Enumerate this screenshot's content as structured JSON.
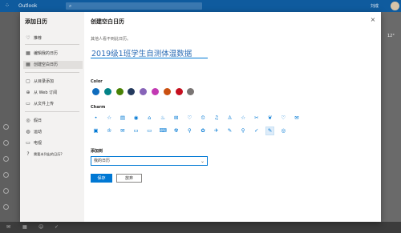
{
  "appbar": {
    "brand": "Outlook",
    "user_name": "刘成"
  },
  "background": {
    "weather": "12°"
  },
  "dialog": {
    "left_title": "添加日历",
    "nav": [
      {
        "icon": "lightbulb-icon",
        "glyph": "♡",
        "label": "推荐"
      },
      {
        "icon": "calendar-edit-icon",
        "glyph": "▦",
        "label": "编辑我的日历"
      },
      {
        "icon": "calendar-add-icon",
        "glyph": "▦",
        "label": "创建空白日历"
      },
      {
        "icon": "folder-import-icon",
        "glyph": "▢",
        "label": "从目录添加"
      },
      {
        "icon": "web-icon",
        "glyph": "⊕",
        "label": "从 Web 订阅"
      },
      {
        "icon": "file-upload-icon",
        "glyph": "▭",
        "label": "从文件上传"
      },
      {
        "icon": "globe-icon",
        "glyph": "◎",
        "label": "假日"
      },
      {
        "icon": "sports-icon",
        "glyph": "◍",
        "label": "运动"
      },
      {
        "icon": "tv-icon",
        "glyph": "▭",
        "label": "电视"
      },
      {
        "icon": "help-icon",
        "glyph": "?",
        "label": "需要未列出的日历?"
      }
    ],
    "title": "创建空白日历",
    "subtitle": "其他人看不到此日历。",
    "calendar_name": "2019级1班学生自测体温数据",
    "color_label": "Color",
    "colors": [
      "#0f6cbd",
      "#038387",
      "#498205",
      "#243a5e",
      "#8764b8",
      "#c239b3",
      "#ca5010",
      "#c50f1f",
      "#7a7574"
    ],
    "charm_label": "Charm",
    "charms_row1": [
      "•",
      "☆",
      "▤",
      "◉",
      "⌂",
      "♨",
      "⊞",
      "♡",
      "⏲",
      "♫",
      "♙",
      "☆",
      "✂",
      "❦",
      "♡",
      "✉"
    ],
    "charms_row2": [
      "▣",
      "♔",
      "✉",
      "▭",
      "▭",
      "⌨",
      "☢",
      "⚲",
      "✿",
      "✈",
      "✎",
      "⚲",
      "✓",
      "✎",
      "◎"
    ],
    "add_to_label": "添加到",
    "add_to_value": "我的日历",
    "save_label": "保存",
    "discard_label": "放弃"
  }
}
